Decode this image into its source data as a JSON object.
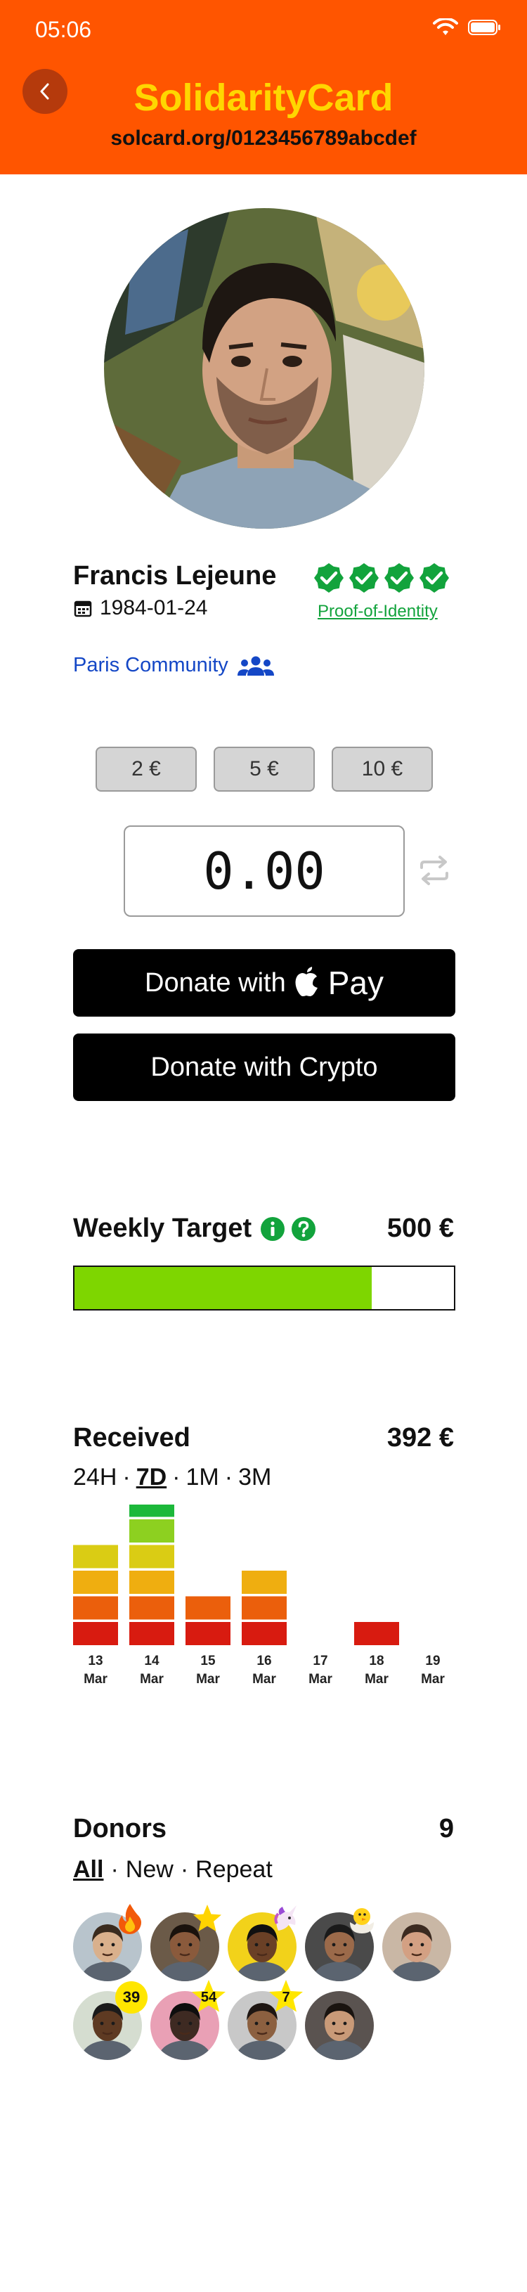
{
  "status_bar": {
    "time": "05:06"
  },
  "header": {
    "title": "SolidarityCard",
    "url": "solcard.org/0123456789abcdef",
    "colors": {
      "background": "#FF5500",
      "title": "#FFD600",
      "back_button": "#B53A0C"
    }
  },
  "profile": {
    "name": "Francis Lejeune",
    "dob": "1984-01-24",
    "proof_label": "Proof-of-Identity",
    "verification_checks": 4,
    "community": "Paris Community",
    "colors": {
      "verified": "#12A33C",
      "community": "#1447C6"
    }
  },
  "donate": {
    "quick_amounts": [
      "2 €",
      "5 €",
      "10 €"
    ],
    "amount_value": "0.00",
    "apple_pay_label": "Donate with",
    "apple_pay_word": "Pay",
    "crypto_label": "Donate with Crypto"
  },
  "weekly_target": {
    "title": "Weekly Target",
    "amount": "500 €",
    "progress_fraction": 0.784,
    "colors": {
      "fill": "#7ED600"
    }
  },
  "received": {
    "title": "Received",
    "amount": "392 €",
    "periods": [
      {
        "label": "24H",
        "active": false
      },
      {
        "label": "7D",
        "active": true
      },
      {
        "label": "1M",
        "active": false
      },
      {
        "label": "3M",
        "active": false
      }
    ]
  },
  "chart_data": {
    "type": "bar",
    "categories": [
      {
        "day": "13",
        "month": "Mar"
      },
      {
        "day": "14",
        "month": "Mar"
      },
      {
        "day": "15",
        "month": "Mar"
      },
      {
        "day": "16",
        "month": "Mar"
      },
      {
        "day": "17",
        "month": "Mar"
      },
      {
        "day": "18",
        "month": "Mar"
      },
      {
        "day": "19",
        "month": "Mar"
      }
    ],
    "values": [
      4,
      6,
      2,
      3,
      0,
      1,
      0
    ],
    "segment_colors": [
      "#D81B10",
      "#EB5F0C",
      "#EFAE10",
      "#DACC14",
      "#8DD020",
      "#1CB83A"
    ]
  },
  "donors": {
    "title": "Donors",
    "count": "9",
    "filters": [
      {
        "label": "All",
        "active": true
      },
      {
        "label": "New",
        "active": false
      },
      {
        "label": "Repeat",
        "active": false
      }
    ],
    "list": [
      {
        "badge": "fire-icon",
        "skin": "#D9B08C",
        "bg": "#B8C4CC",
        "hair": "#3A2B1E"
      },
      {
        "badge": "star-icon",
        "skin": "#8A5A3C",
        "bg": "#6B5A48",
        "hair": "#1A120C"
      },
      {
        "badge": "unicorn-icon",
        "skin": "#6A4026",
        "bg": "#F2D21A",
        "hair": "#101010"
      },
      {
        "badge": "chick-icon",
        "skin": "#9B6A4A",
        "bg": "#4A4A4A",
        "hair": "#1A1A1A"
      },
      {
        "badge": "",
        "skin": "#D3A083",
        "bg": "#C9B7A5",
        "hair": "#3B2A20"
      },
      {
        "badge": "39",
        "skin": "#5E3A22",
        "bg": "#D5DDD0",
        "hair": "#1A1A1A"
      },
      {
        "badge": "54",
        "skin": "#3E2A22",
        "bg": "#E9A0B5",
        "hair": "#0E0E0E"
      },
      {
        "badge": "7",
        "skin": "#8C6040",
        "bg": "#C8C8C8",
        "hair": "#1E1612"
      },
      {
        "badge": "",
        "skin": "#C99A78",
        "bg": "#5A5350",
        "hair": "#1A1410"
      }
    ]
  }
}
